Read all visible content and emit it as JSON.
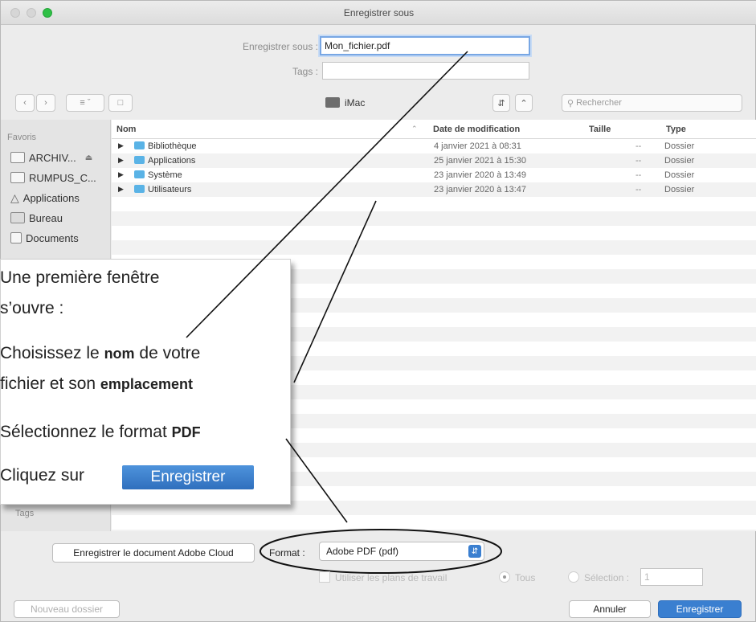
{
  "window": {
    "title": "Enregistrer sous"
  },
  "form": {
    "save_as_label": "Enregistrer sous :",
    "save_as_value": "Mon_fichier.pdf",
    "tags_label": "Tags :",
    "tags_value": ""
  },
  "toolbar": {
    "location": "iMac",
    "search_placeholder": "Rechercher"
  },
  "sidebar": {
    "section": "Favoris",
    "items": [
      {
        "label": "ARCHIV...",
        "icon": "drive-icon"
      },
      {
        "label": "RUMPUS_C...",
        "icon": "folder-icon"
      },
      {
        "label": "Applications",
        "icon": "applications-icon"
      },
      {
        "label": "Bureau",
        "icon": "desktop-icon"
      },
      {
        "label": "Documents",
        "icon": "documents-icon"
      }
    ],
    "tags_section": "Tags"
  },
  "table": {
    "headers": {
      "name": "Nom",
      "date": "Date de modification",
      "size": "Taille",
      "type": "Type"
    },
    "rows": [
      {
        "name": "Bibliothèque",
        "date": "4 janvier 2021 à 08:31",
        "size": "--",
        "type": "Dossier"
      },
      {
        "name": "Applications",
        "date": "25 janvier 2021 à 15:30",
        "size": "--",
        "type": "Dossier"
      },
      {
        "name": "Système",
        "date": "23 janvier 2020 à 13:49",
        "size": "--",
        "type": "Dossier"
      },
      {
        "name": "Utilisateurs",
        "date": "23 janvier 2020 à 13:47",
        "size": "--",
        "type": "Dossier"
      }
    ]
  },
  "bottom": {
    "adobe_cloud_button": "Enregistrer le document Adobe Cloud",
    "format_label": "Format :",
    "format_value": "Adobe PDF (pdf)",
    "artboards_label": "Utiliser les plans de travail",
    "all_label": "Tous",
    "selection_label": "Sélection :",
    "selection_value": "1",
    "new_folder_button": "Nouveau dossier",
    "cancel_button": "Annuler",
    "save_button": "Enregistrer"
  },
  "overlay": {
    "line1": "Une première fenêtre",
    "line2": "s’ouvre :",
    "line3a": "Choisissez le ",
    "line3b": "nom",
    "line3c": " de votre",
    "line4a": "fichier et son ",
    "line4b": "emplacement",
    "line5a": "Sélectionnez le format ",
    "line5b": "PDF",
    "line6": "Cliquez sur",
    "button": "Enregistrer"
  },
  "colors": {
    "accent": "#3a7fd0",
    "folder": "#5ab3e6"
  }
}
